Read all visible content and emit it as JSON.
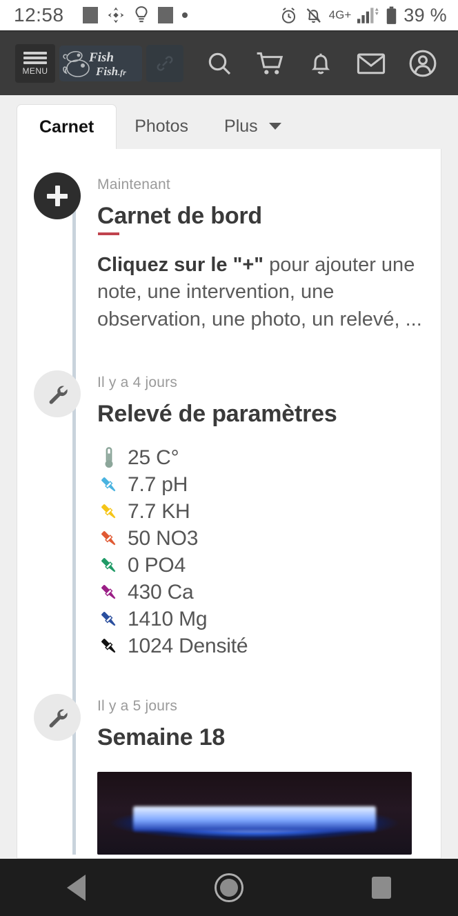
{
  "status_bar": {
    "time": "12:58",
    "battery_percent": "39 %",
    "network": "4G+",
    "icons_left": [
      "square-icon",
      "diamond-icon",
      "lightbulb-icon",
      "square-icon",
      "dot-icon"
    ],
    "icons_right": [
      "alarm-icon",
      "bell-off-icon",
      "signal-icon",
      "battery-icon"
    ]
  },
  "header": {
    "menu_label": "MENU",
    "logo_line1": "Fish",
    "logo_line2": "Fish.fr",
    "icons": [
      "link-icon",
      "search-icon",
      "cart-icon",
      "bell-icon",
      "mail-icon",
      "account-icon"
    ]
  },
  "tabs": [
    {
      "label": "Carnet",
      "active": true
    },
    {
      "label": "Photos",
      "active": false
    },
    {
      "label": "Plus",
      "active": false,
      "has_caret": true
    }
  ],
  "timeline": {
    "entries": [
      {
        "icon": "plus-icon",
        "meta": "Maintenant",
        "title": "Carnet de bord",
        "body_bold": "Cliquez sur le \"+\"",
        "body_rest": " pour ajouter une note, une intervention, une observation, une photo, un relevé, ..."
      },
      {
        "icon": "wrench-icon",
        "meta": "Il y a 4 jours",
        "title": "Relevé de paramètres",
        "params": [
          {
            "icon": "thermometer-icon",
            "color": "#8ca69a",
            "value": "25 C°"
          },
          {
            "icon": "dropper-icon",
            "color": "#4ab3e0",
            "value": "7.7 pH"
          },
          {
            "icon": "dropper-icon",
            "color": "#f5c518",
            "value": "7.7 KH"
          },
          {
            "icon": "dropper-icon",
            "color": "#e05a34",
            "value": "50 NO3"
          },
          {
            "icon": "dropper-icon",
            "color": "#1f9a66",
            "value": "0 PO4"
          },
          {
            "icon": "dropper-icon",
            "color": "#9b1f86",
            "value": "430 Ca"
          },
          {
            "icon": "dropper-icon",
            "color": "#2b4f9e",
            "value": "1410 Mg"
          },
          {
            "icon": "dropper-icon",
            "color": "#111111",
            "value": "1024 Densité"
          }
        ]
      },
      {
        "icon": "wrench-icon",
        "meta": "Il y a 5 jours",
        "title": "Semaine 18",
        "has_photo": true
      }
    ]
  },
  "nav_bar": {
    "back": "back-icon",
    "home": "home-icon",
    "recents": "recents-icon"
  },
  "colors": {
    "accent_red": "#c0434e",
    "header_bg": "#3b3b3b",
    "timeline_line": "#c9d3dc",
    "page_bg": "#efefef"
  }
}
